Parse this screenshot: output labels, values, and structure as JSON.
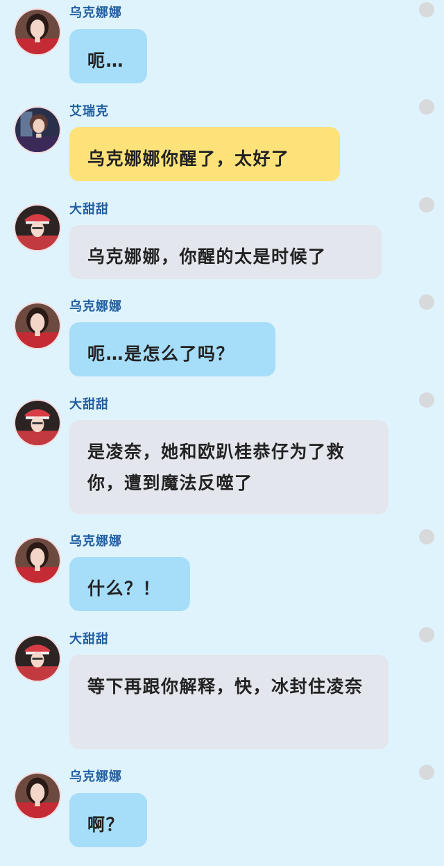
{
  "messages": [
    {
      "sender": "乌克娜娜",
      "text": "呃…",
      "bubble_color": "#a6ddf8",
      "avatar": "ukenana-avatar"
    },
    {
      "sender": "艾瑞克",
      "text": "乌克娜娜你醒了，太好了",
      "bubble_color": "#fde27a",
      "avatar": "eric-avatar"
    },
    {
      "sender": "大甜甜",
      "text": "乌克娜娜，你醒的太是时候了",
      "bubble_color": "#e3e6ec",
      "avatar": "datiantian-avatar"
    },
    {
      "sender": "乌克娜娜",
      "text": "呃…是怎么了吗？",
      "bubble_color": "#a6ddf8",
      "avatar": "ukenana-avatar"
    },
    {
      "sender": "大甜甜",
      "text": "是凌奈，她和欧趴桂恭仔为了救你，遭到魔法反噬了",
      "bubble_color": "#e3e6ec",
      "avatar": "datiantian-avatar"
    },
    {
      "sender": "乌克娜娜",
      "text": "什么？！",
      "bubble_color": "#a6ddf8",
      "avatar": "ukenana-avatar"
    },
    {
      "sender": "大甜甜",
      "text": "等下再跟你解释，快，冰封住凌奈",
      "bubble_color": "#e3e6ec",
      "avatar": "datiantian-avatar"
    },
    {
      "sender": "乌克娜娜",
      "text": "啊？",
      "bubble_color": "#a6ddf8",
      "avatar": "ukenana-avatar"
    }
  ]
}
